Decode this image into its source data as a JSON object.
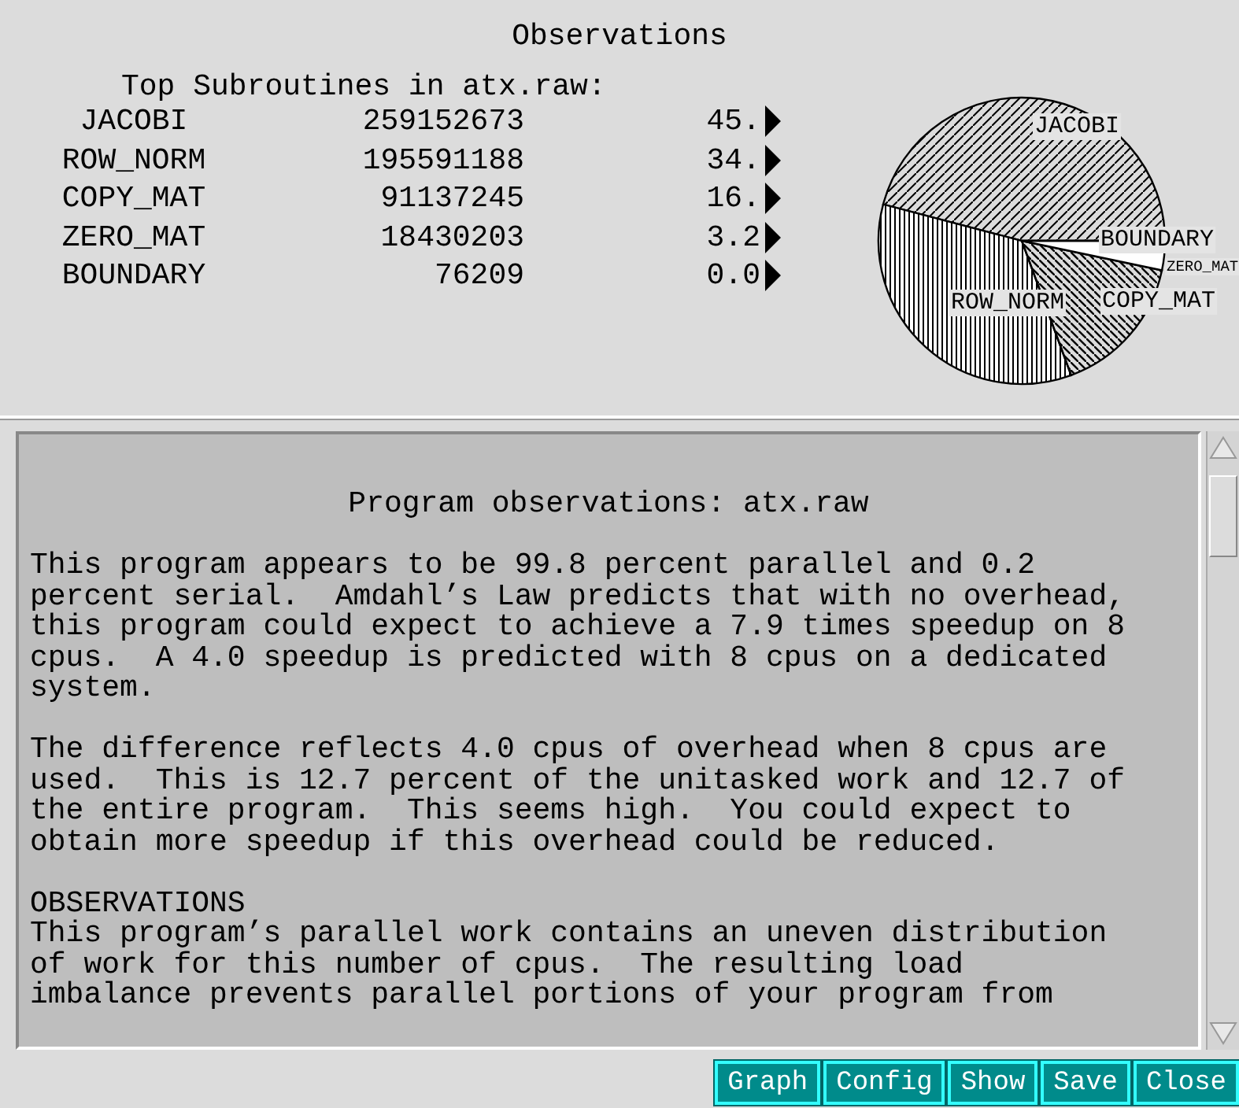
{
  "window": {
    "title": "Observations"
  },
  "subroutines": {
    "heading": "Top Subroutines in atx.raw:",
    "rows": [
      {
        "name": "JACOBI",
        "count": "259152673",
        "percent": "45."
      },
      {
        "name": "ROW_NORM",
        "count": "195591188",
        "percent": "34."
      },
      {
        "name": "COPY_MAT",
        "count": "91137245",
        "percent": "16."
      },
      {
        "name": "ZERO_MAT",
        "count": "18430203",
        "percent": "3.2"
      },
      {
        "name": "BOUNDARY",
        "count": "76209",
        "percent": "0.0"
      }
    ],
    "chart_data": {
      "type": "pie",
      "categories": [
        "JACOBI",
        "ROW_NORM",
        "COPY_MAT",
        "ZERO_MAT",
        "BOUNDARY"
      ],
      "values": [
        45.9,
        34.7,
        16.1,
        3.3,
        0.0
      ]
    }
  },
  "report": {
    "title": "Program observations: atx.raw",
    "sections": [
      {
        "paragraph": "This program appears to be 99.8 percent parallel and 0.2\npercent serial.  Amdahl’s Law predicts that with no overhead,\nthis program could expect to achieve a 7.9 times speedup on 8\ncpus.  A 4.0 speedup is predicted with 8 cpus on a dedicated\nsystem."
      },
      {
        "paragraph": "The difference reflects 4.0 cpus of overhead when 8 cpus are\nused.  This is 12.7 percent of the unitasked work and 12.7 of\nthe entire program.  This seems high.  You could expect to\nobtain more speedup if this overhead could be reduced."
      },
      {
        "heading": "OBSERVATIONS",
        "paragraph": "This program’s parallel work contains an uneven distribution\nof work for this number of cpus.  The resulting load\nimbalance prevents parallel portions of your program from"
      }
    ]
  },
  "buttons": [
    "Graph",
    "Config",
    "Show",
    "Save",
    "Close"
  ]
}
